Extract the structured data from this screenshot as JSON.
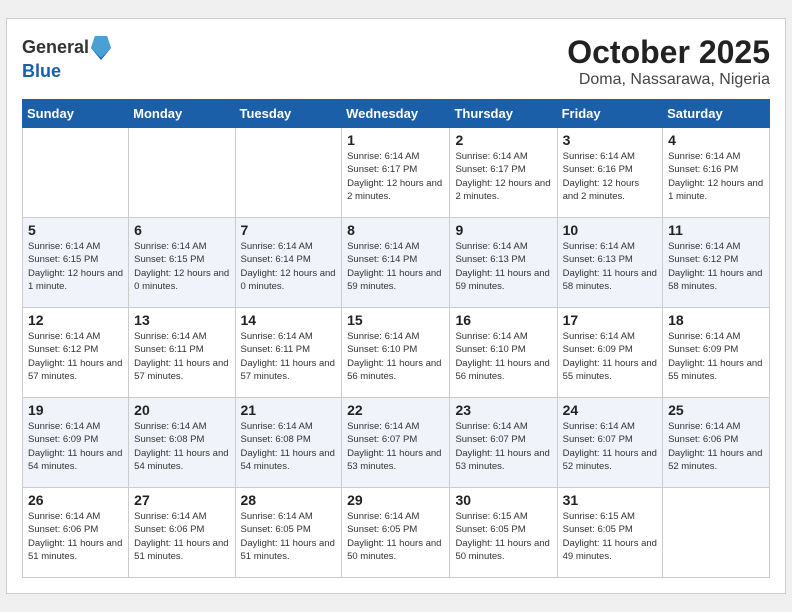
{
  "header": {
    "logo_general": "General",
    "logo_blue": "Blue",
    "month": "October 2025",
    "location": "Doma, Nassarawa, Nigeria"
  },
  "weekdays": [
    "Sunday",
    "Monday",
    "Tuesday",
    "Wednesday",
    "Thursday",
    "Friday",
    "Saturday"
  ],
  "weeks": [
    [
      {
        "day": "",
        "sunrise": "",
        "sunset": "",
        "daylight": ""
      },
      {
        "day": "",
        "sunrise": "",
        "sunset": "",
        "daylight": ""
      },
      {
        "day": "",
        "sunrise": "",
        "sunset": "",
        "daylight": ""
      },
      {
        "day": "1",
        "sunrise": "Sunrise: 6:14 AM",
        "sunset": "Sunset: 6:17 PM",
        "daylight": "Daylight: 12 hours and 2 minutes."
      },
      {
        "day": "2",
        "sunrise": "Sunrise: 6:14 AM",
        "sunset": "Sunset: 6:17 PM",
        "daylight": "Daylight: 12 hours and 2 minutes."
      },
      {
        "day": "3",
        "sunrise": "Sunrise: 6:14 AM",
        "sunset": "Sunset: 6:16 PM",
        "daylight": "Daylight: 12 hours and 2 minutes."
      },
      {
        "day": "4",
        "sunrise": "Sunrise: 6:14 AM",
        "sunset": "Sunset: 6:16 PM",
        "daylight": "Daylight: 12 hours and 1 minute."
      }
    ],
    [
      {
        "day": "5",
        "sunrise": "Sunrise: 6:14 AM",
        "sunset": "Sunset: 6:15 PM",
        "daylight": "Daylight: 12 hours and 1 minute."
      },
      {
        "day": "6",
        "sunrise": "Sunrise: 6:14 AM",
        "sunset": "Sunset: 6:15 PM",
        "daylight": "Daylight: 12 hours and 0 minutes."
      },
      {
        "day": "7",
        "sunrise": "Sunrise: 6:14 AM",
        "sunset": "Sunset: 6:14 PM",
        "daylight": "Daylight: 12 hours and 0 minutes."
      },
      {
        "day": "8",
        "sunrise": "Sunrise: 6:14 AM",
        "sunset": "Sunset: 6:14 PM",
        "daylight": "Daylight: 11 hours and 59 minutes."
      },
      {
        "day": "9",
        "sunrise": "Sunrise: 6:14 AM",
        "sunset": "Sunset: 6:13 PM",
        "daylight": "Daylight: 11 hours and 59 minutes."
      },
      {
        "day": "10",
        "sunrise": "Sunrise: 6:14 AM",
        "sunset": "Sunset: 6:13 PM",
        "daylight": "Daylight: 11 hours and 58 minutes."
      },
      {
        "day": "11",
        "sunrise": "Sunrise: 6:14 AM",
        "sunset": "Sunset: 6:12 PM",
        "daylight": "Daylight: 11 hours and 58 minutes."
      }
    ],
    [
      {
        "day": "12",
        "sunrise": "Sunrise: 6:14 AM",
        "sunset": "Sunset: 6:12 PM",
        "daylight": "Daylight: 11 hours and 57 minutes."
      },
      {
        "day": "13",
        "sunrise": "Sunrise: 6:14 AM",
        "sunset": "Sunset: 6:11 PM",
        "daylight": "Daylight: 11 hours and 57 minutes."
      },
      {
        "day": "14",
        "sunrise": "Sunrise: 6:14 AM",
        "sunset": "Sunset: 6:11 PM",
        "daylight": "Daylight: 11 hours and 57 minutes."
      },
      {
        "day": "15",
        "sunrise": "Sunrise: 6:14 AM",
        "sunset": "Sunset: 6:10 PM",
        "daylight": "Daylight: 11 hours and 56 minutes."
      },
      {
        "day": "16",
        "sunrise": "Sunrise: 6:14 AM",
        "sunset": "Sunset: 6:10 PM",
        "daylight": "Daylight: 11 hours and 56 minutes."
      },
      {
        "day": "17",
        "sunrise": "Sunrise: 6:14 AM",
        "sunset": "Sunset: 6:09 PM",
        "daylight": "Daylight: 11 hours and 55 minutes."
      },
      {
        "day": "18",
        "sunrise": "Sunrise: 6:14 AM",
        "sunset": "Sunset: 6:09 PM",
        "daylight": "Daylight: 11 hours and 55 minutes."
      }
    ],
    [
      {
        "day": "19",
        "sunrise": "Sunrise: 6:14 AM",
        "sunset": "Sunset: 6:09 PM",
        "daylight": "Daylight: 11 hours and 54 minutes."
      },
      {
        "day": "20",
        "sunrise": "Sunrise: 6:14 AM",
        "sunset": "Sunset: 6:08 PM",
        "daylight": "Daylight: 11 hours and 54 minutes."
      },
      {
        "day": "21",
        "sunrise": "Sunrise: 6:14 AM",
        "sunset": "Sunset: 6:08 PM",
        "daylight": "Daylight: 11 hours and 54 minutes."
      },
      {
        "day": "22",
        "sunrise": "Sunrise: 6:14 AM",
        "sunset": "Sunset: 6:07 PM",
        "daylight": "Daylight: 11 hours and 53 minutes."
      },
      {
        "day": "23",
        "sunrise": "Sunrise: 6:14 AM",
        "sunset": "Sunset: 6:07 PM",
        "daylight": "Daylight: 11 hours and 53 minutes."
      },
      {
        "day": "24",
        "sunrise": "Sunrise: 6:14 AM",
        "sunset": "Sunset: 6:07 PM",
        "daylight": "Daylight: 11 hours and 52 minutes."
      },
      {
        "day": "25",
        "sunrise": "Sunrise: 6:14 AM",
        "sunset": "Sunset: 6:06 PM",
        "daylight": "Daylight: 11 hours and 52 minutes."
      }
    ],
    [
      {
        "day": "26",
        "sunrise": "Sunrise: 6:14 AM",
        "sunset": "Sunset: 6:06 PM",
        "daylight": "Daylight: 11 hours and 51 minutes."
      },
      {
        "day": "27",
        "sunrise": "Sunrise: 6:14 AM",
        "sunset": "Sunset: 6:06 PM",
        "daylight": "Daylight: 11 hours and 51 minutes."
      },
      {
        "day": "28",
        "sunrise": "Sunrise: 6:14 AM",
        "sunset": "Sunset: 6:05 PM",
        "daylight": "Daylight: 11 hours and 51 minutes."
      },
      {
        "day": "29",
        "sunrise": "Sunrise: 6:14 AM",
        "sunset": "Sunset: 6:05 PM",
        "daylight": "Daylight: 11 hours and 50 minutes."
      },
      {
        "day": "30",
        "sunrise": "Sunrise: 6:15 AM",
        "sunset": "Sunset: 6:05 PM",
        "daylight": "Daylight: 11 hours and 50 minutes."
      },
      {
        "day": "31",
        "sunrise": "Sunrise: 6:15 AM",
        "sunset": "Sunset: 6:05 PM",
        "daylight": "Daylight: 11 hours and 49 minutes."
      },
      {
        "day": "",
        "sunrise": "",
        "sunset": "",
        "daylight": ""
      }
    ]
  ]
}
